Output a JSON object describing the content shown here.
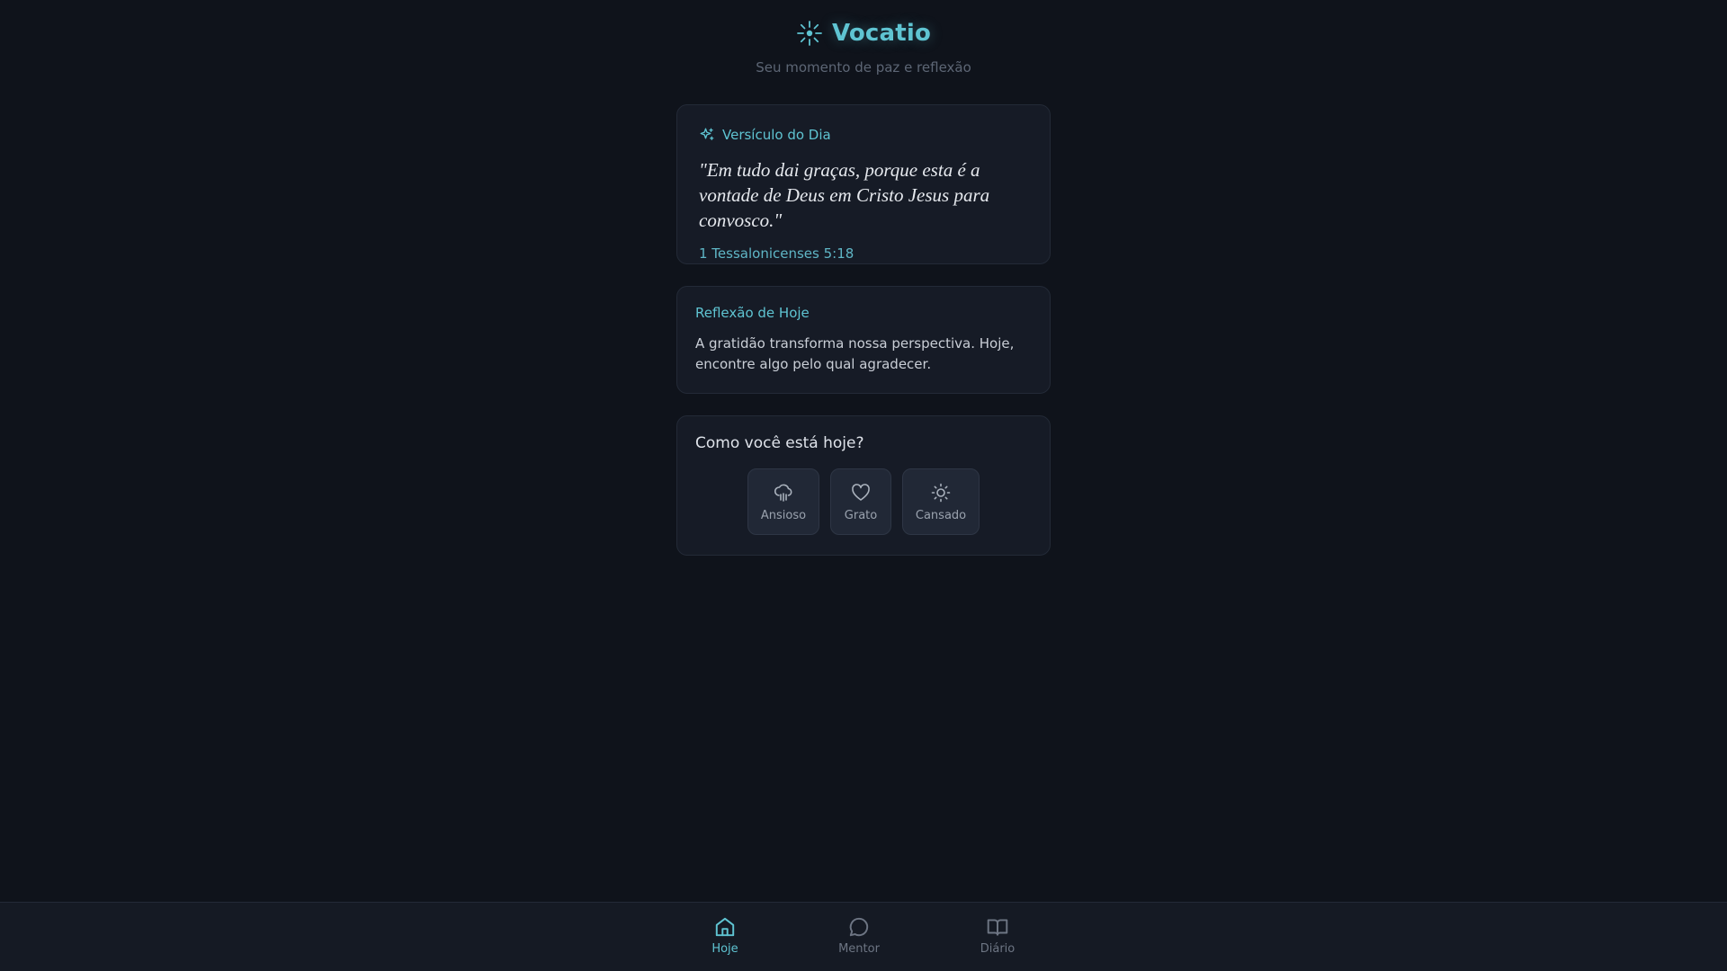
{
  "app": {
    "title": "Vocatio",
    "subtitle": "Seu momento de paz e reflexão",
    "brand_icon": "sun-burst-icon"
  },
  "colors": {
    "background": "#0f131b",
    "card": "#161b26",
    "accent": "#5fc4d2",
    "muted_text": "#6d7583"
  },
  "verse": {
    "label": "Versículo do Dia",
    "label_icon": "sparkles-icon",
    "text": "\"Em tudo dai graças, porque esta é a vontade de Deus em Cristo Jesus para convosco.\"",
    "reference": "1 Tessalonicenses 5:18"
  },
  "reflection": {
    "title": "Reflexão de Hoje",
    "text": "A gratidão transforma nossa perspectiva. Hoje, encontre algo pelo qual agradecer."
  },
  "mood": {
    "question": "Como você está hoje?",
    "options": [
      {
        "label": "Ansioso",
        "icon": "cloud-rain-icon"
      },
      {
        "label": "Grato",
        "icon": "heart-icon"
      },
      {
        "label": "Cansado",
        "icon": "sun-icon"
      }
    ]
  },
  "nav": {
    "items": [
      {
        "label": "Hoje",
        "icon": "home-icon",
        "active": true
      },
      {
        "label": "Mentor",
        "icon": "chat-bubble-icon",
        "active": false
      },
      {
        "label": "Diário",
        "icon": "book-open-icon",
        "active": false
      }
    ]
  }
}
